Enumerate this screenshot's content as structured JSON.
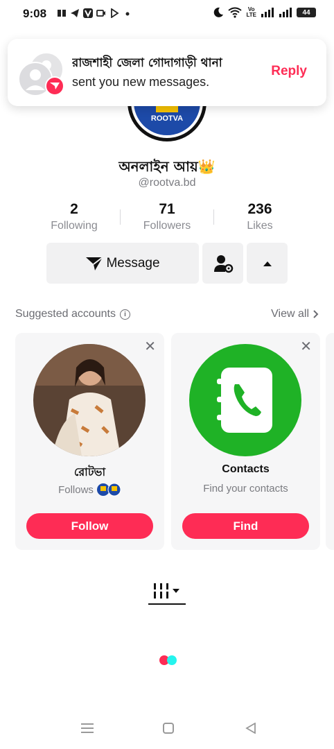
{
  "status_bar": {
    "time": "9:08",
    "volte_top": "Vo",
    "volte_bottom": "LTE",
    "battery": "44"
  },
  "profile": {
    "avatar_text": "ROOTVA",
    "name": "অনলাইন আয়👑",
    "handle": "@rootva.bd",
    "stats": [
      {
        "value": "2",
        "label": "Following"
      },
      {
        "value": "71",
        "label": "Followers"
      },
      {
        "value": "236",
        "label": "Likes"
      }
    ],
    "message_label": "Message"
  },
  "suggested": {
    "title": "Suggested accounts",
    "view_all": "View all",
    "cards": [
      {
        "name": "রোটভা",
        "subtitle": "Follows",
        "button": "Follow"
      },
      {
        "name": "Contacts",
        "subtitle": "Find your contacts",
        "button": "Find"
      }
    ]
  },
  "notification": {
    "title": "রাজশাহী জেলা গোদাগাড়ী থানা",
    "body": "sent you new messages.",
    "action": "Reply"
  },
  "colors": {
    "accent": "#fe2c55",
    "contacts_green": "#1fb226",
    "loader_red": "#fe2c55",
    "loader_cyan": "#25f4ee"
  }
}
